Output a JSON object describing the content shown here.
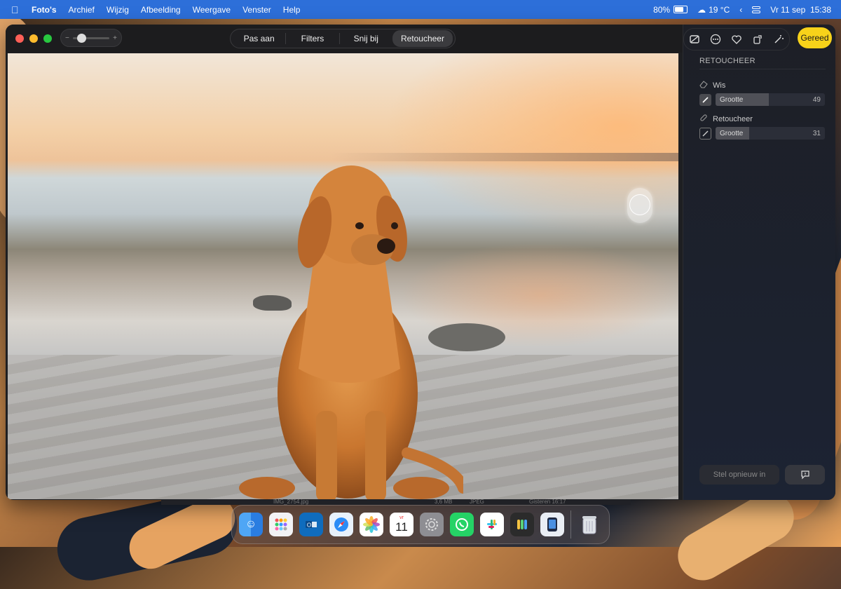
{
  "menubar": {
    "app": "Foto's",
    "menus": [
      "Archief",
      "Wijzig",
      "Afbeelding",
      "Weergave",
      "Venster",
      "Help"
    ],
    "battery": "80%",
    "weather": "19 °C",
    "datetime": "Vr 11 sep  15:38"
  },
  "toolbar": {
    "zoom_minus": "−",
    "zoom_plus": "+",
    "tabs": [
      "Pas aan",
      "Filters",
      "Snij bij",
      "Retoucheer"
    ],
    "active_tab": "Retoucheer"
  },
  "panel": {
    "done_label": "Gereed",
    "title": "RETOUCHEER",
    "erase": {
      "label": "Wis",
      "slider_label": "Grootte",
      "value": "49",
      "fill_percent": 49
    },
    "retouch": {
      "label": "Retoucheer",
      "slider_label": "Grootte",
      "value": "31",
      "fill_percent": 31
    },
    "reset_label": "Stel opnieuw in"
  },
  "statusbar": {
    "filename": "IMG_2754.jpg",
    "size": "3,6 MB",
    "format": "JPEG",
    "status": "Gisteren 16:17"
  },
  "dock": {
    "apps": [
      "finder",
      "launchpad",
      "outlook",
      "safari",
      "photos",
      "calendar",
      "system-settings",
      "whatsapp",
      "slack",
      "keychain",
      "simulator",
      "trash"
    ],
    "calendar_day": "11",
    "calendar_month": "vr"
  },
  "colors": {
    "menubar": "#2d6fd9",
    "accent_done": "#f7d21a",
    "panel_bg": "#1c2333"
  }
}
